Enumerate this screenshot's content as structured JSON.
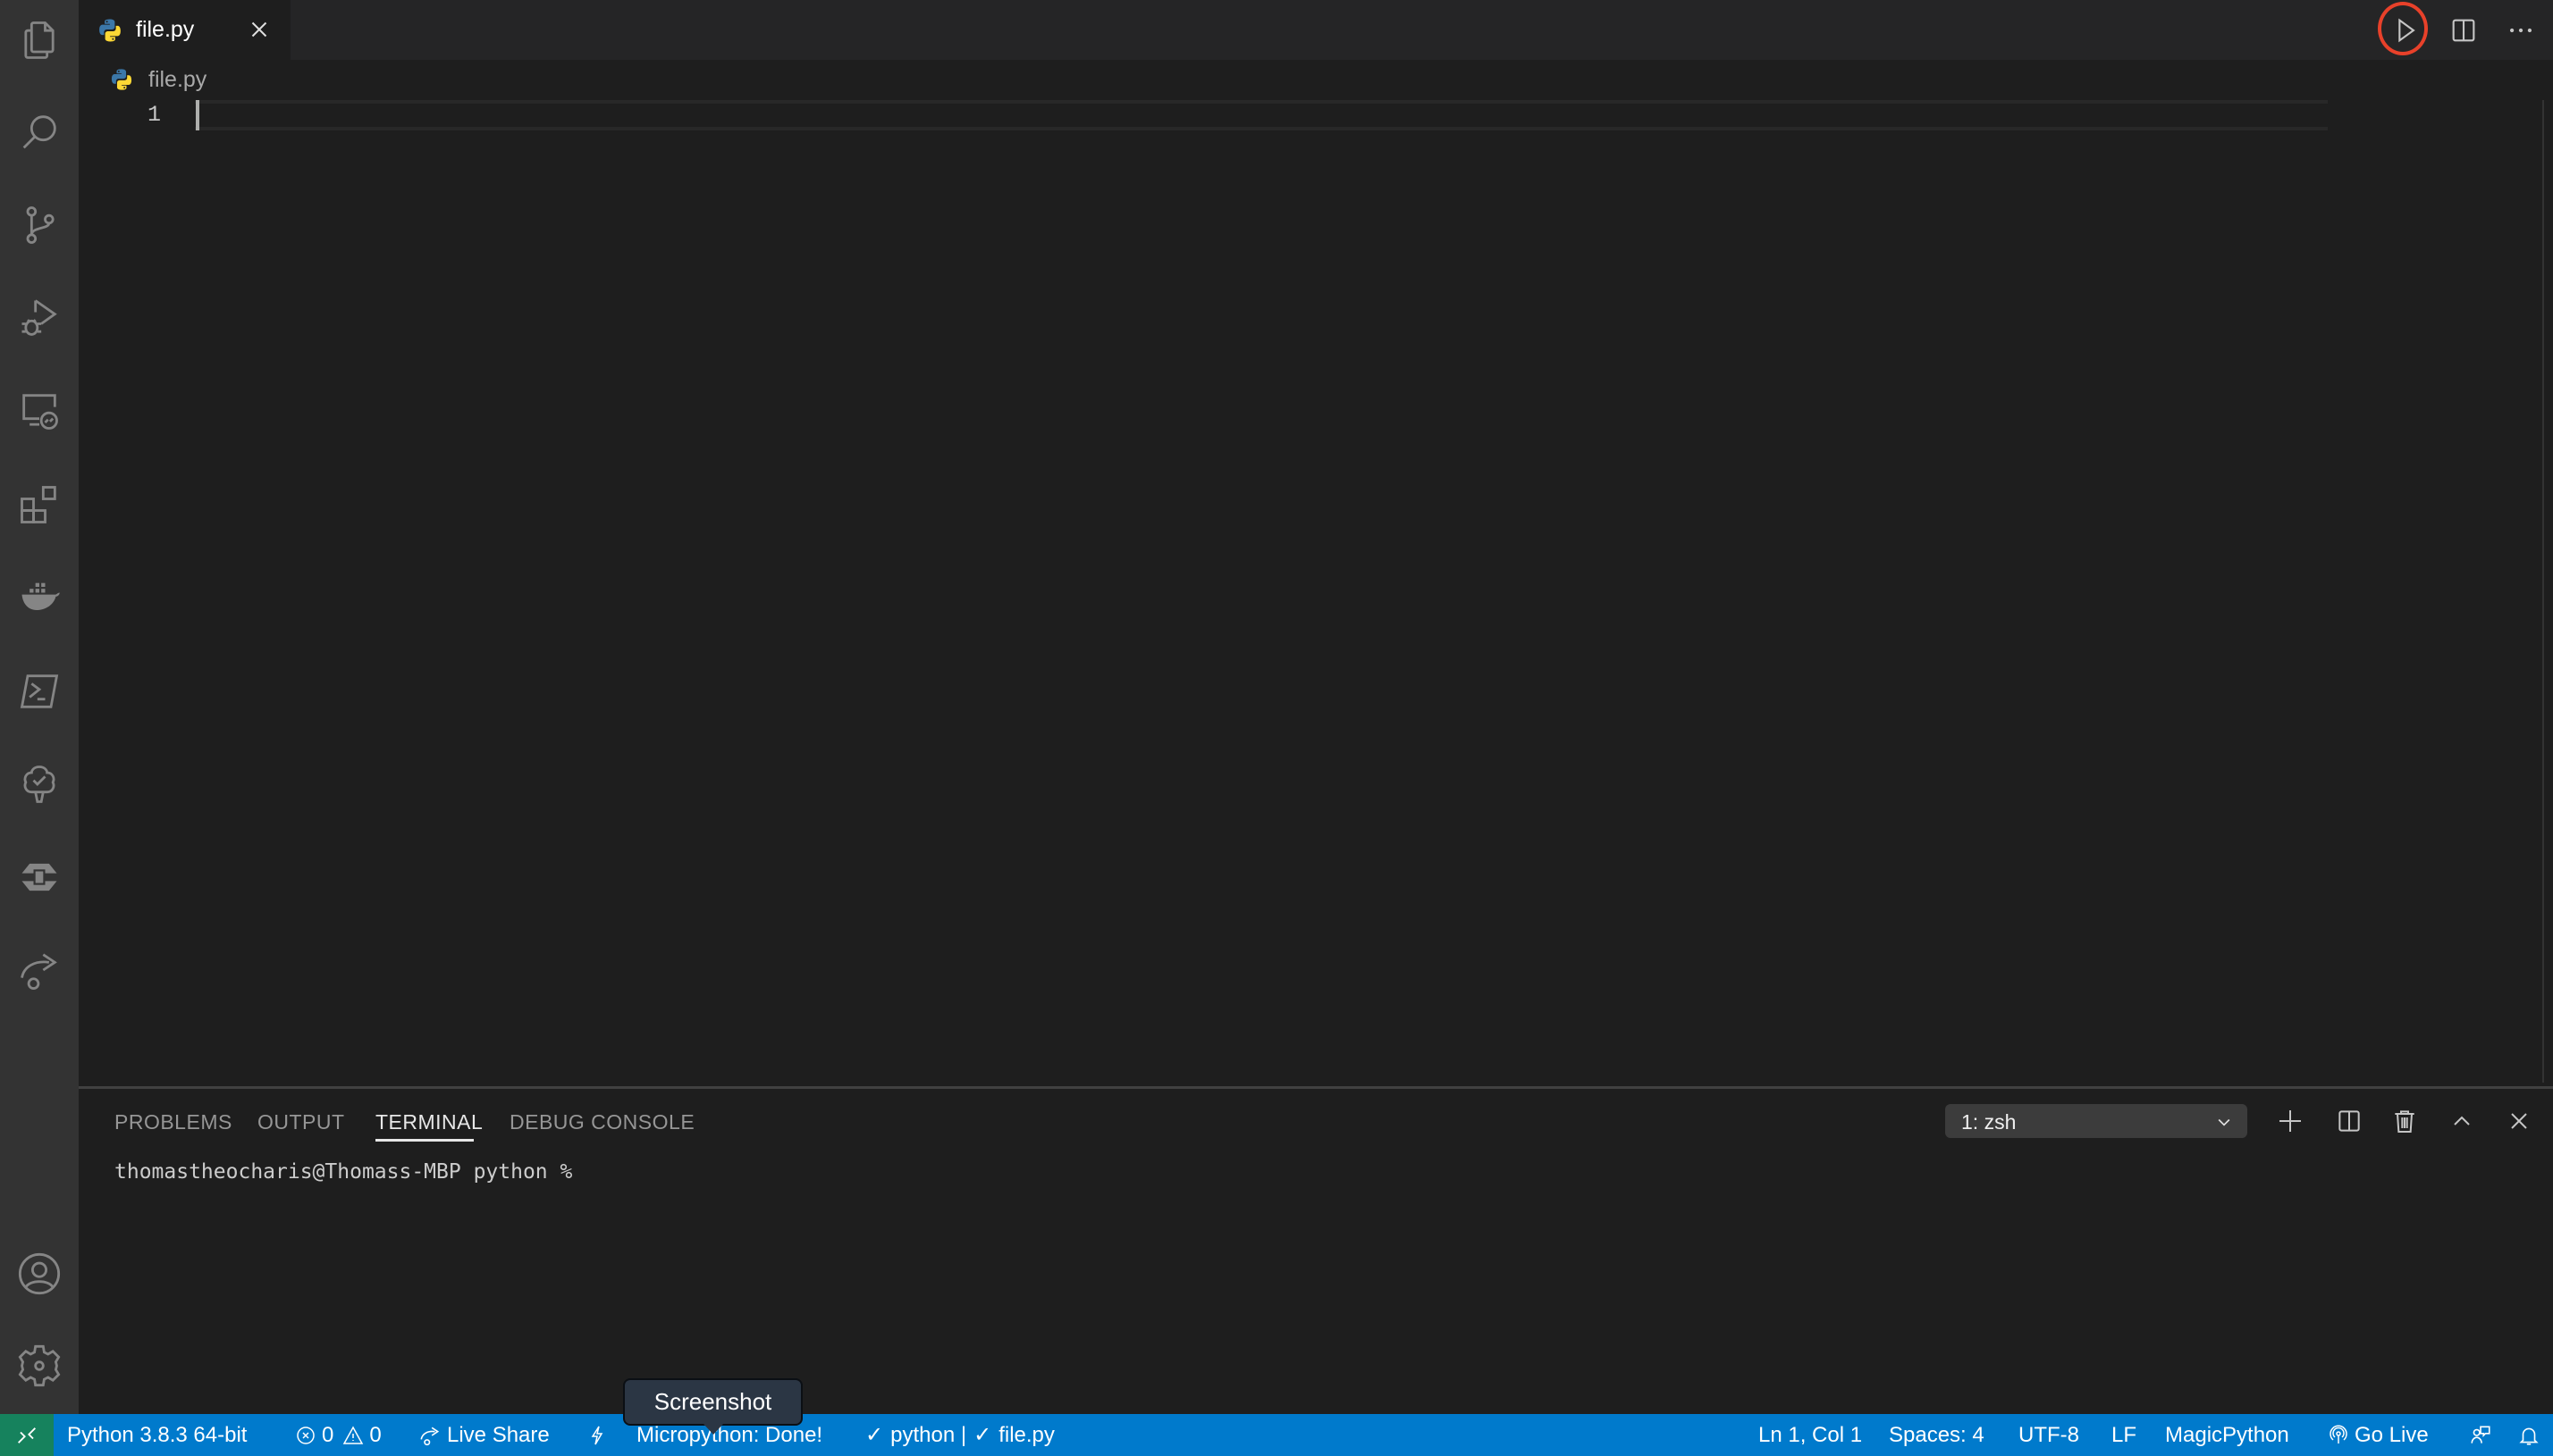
{
  "activity_bar": {
    "items": [
      {
        "name": "explorer",
        "icon": "files-icon"
      },
      {
        "name": "search",
        "icon": "search-icon"
      },
      {
        "name": "source-control",
        "icon": "source-control-icon"
      },
      {
        "name": "run-debug",
        "icon": "run-debug-icon"
      },
      {
        "name": "remote-explorer",
        "icon": "remote-explorer-icon"
      },
      {
        "name": "extensions",
        "icon": "extensions-icon"
      },
      {
        "name": "docker",
        "icon": "docker-icon"
      },
      {
        "name": "powershell",
        "icon": "terminal-icon"
      },
      {
        "name": "test",
        "icon": "tree-check-icon"
      },
      {
        "name": "live-server",
        "icon": "chip-icon"
      },
      {
        "name": "live-share",
        "icon": "share-arrow-icon"
      }
    ],
    "bottom": [
      {
        "name": "accounts",
        "icon": "account-icon"
      },
      {
        "name": "manage",
        "icon": "gear-icon"
      }
    ]
  },
  "tabs": [
    {
      "label": "file.py",
      "active": true,
      "icon": "python-icon"
    }
  ],
  "editor_actions": [
    "run-python-file",
    "split-editor",
    "more-actions"
  ],
  "breadcrumb": {
    "file": "file.py"
  },
  "editor": {
    "lines": [
      "1"
    ],
    "content": [
      ""
    ]
  },
  "panel": {
    "tabs": [
      {
        "label": "PROBLEMS",
        "active": false
      },
      {
        "label": "OUTPUT",
        "active": false
      },
      {
        "label": "TERMINAL",
        "active": true
      },
      {
        "label": "DEBUG CONSOLE",
        "active": false
      }
    ],
    "terminal_select": "1: zsh",
    "terminal_prompt": "thomastheocharis@Thomass-MBP python %"
  },
  "status_bar": {
    "interpreter": "Python 3.8.3 64-bit",
    "errors": "0",
    "warnings": "0",
    "live_share": "Live Share",
    "micropython": "Micropython: Done!",
    "check_python": "python |",
    "check_file": "file.py",
    "position": "Ln 1, Col 1",
    "spaces": "Spaces: 4",
    "encoding": "UTF-8",
    "eol": "LF",
    "language": "MagicPython",
    "go_live": "Go Live"
  },
  "tooltip": "Screenshot",
  "colors": {
    "status_bar": "#007acc",
    "remote_indicator": "#16825d",
    "highlight_circle": "#e8412a",
    "editor_bg": "#1e1e1e",
    "activity_bar": "#333333"
  }
}
